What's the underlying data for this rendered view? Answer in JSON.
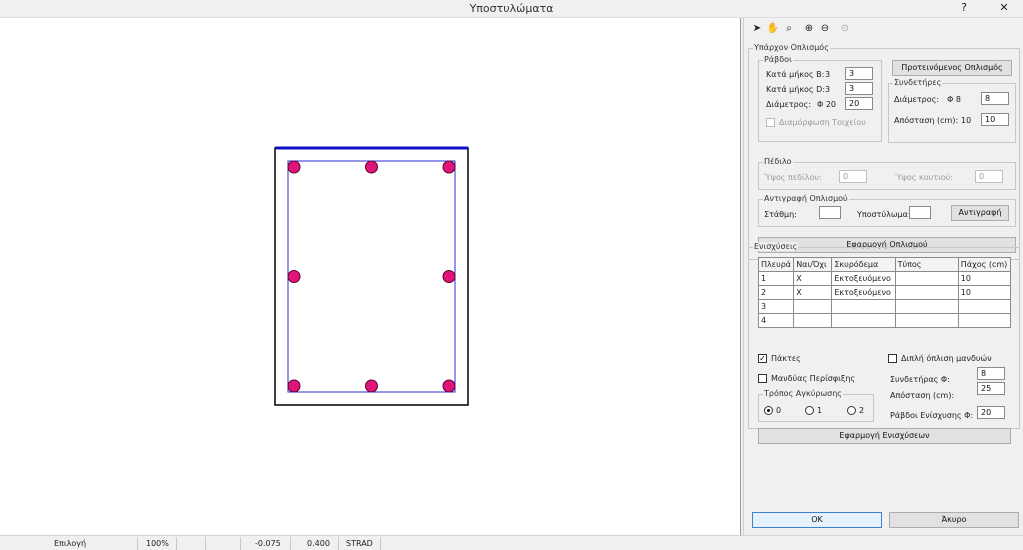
{
  "window": {
    "title": "Υποστυλώματα",
    "help_label": "?",
    "close_label": "✕"
  },
  "toolbar": {
    "icons": [
      "pointer-icon",
      "pan-hand-icon",
      "zoom-window-icon",
      "zoom-in-icon",
      "zoom-out-icon",
      "zoom-extents-icon"
    ]
  },
  "existing": {
    "title": "Υπάρχον Οπλισμός",
    "rebars": {
      "title": "Ράβδοι",
      "length_b_label": "Κατά μήκος Β:",
      "length_b_current": "3",
      "length_b_value": "3",
      "length_d_label": "Κατά μήκος D:",
      "length_d_current": "3",
      "length_d_value": "3",
      "diameter_label": "Διάμετρος:",
      "diameter_current": "Φ 20",
      "diameter_value": "20",
      "formwork_label": "Διαμόρφωση Τοιχείου"
    },
    "proposed_button": "Προτεινόμενος Οπλισμός",
    "stirrups": {
      "title": "Συνδετήρες",
      "diameter_label": "Διάμετρος:",
      "diameter_current": "Φ 8",
      "diameter_value": "8",
      "spacing_label": "Απόσταση (cm):",
      "spacing_current": "10",
      "spacing_value": "10"
    },
    "footing": {
      "title": "Πέδιλο",
      "footing_height_label": "Ύψος πεδίλου:",
      "footing_height_value": "0",
      "box_height_label": "Ύψος κουτιού:",
      "box_height_value": "0"
    },
    "copy": {
      "title": "Αντιγραφή Οπλισμού",
      "level_label": "Στάθμη:",
      "level_value": "",
      "column_label": "Υποστύλωμα:",
      "column_value": "",
      "copy_button": "Αντιγραφή"
    },
    "apply_button": "Εφαρμογή Οπλισμού"
  },
  "reinforcement": {
    "title": "Ενισχύσεις",
    "columns": [
      "Πλευρά",
      "Ναι/Όχι",
      "Σκυρόδεμα",
      "Τύπος",
      "Πάχος (cm)"
    ],
    "rows": [
      {
        "side": "1",
        "yesno": "X",
        "concrete": "Εκτοξευόμενο",
        "type": "",
        "thickness": "10"
      },
      {
        "side": "2",
        "yesno": "X",
        "concrete": "Εκτοξευόμενο",
        "type": "",
        "thickness": "10"
      },
      {
        "side": "3",
        "yesno": "",
        "concrete": "",
        "type": "",
        "thickness": ""
      },
      {
        "side": "4",
        "yesno": "",
        "concrete": "",
        "type": "",
        "thickness": ""
      }
    ],
    "full_height_label": "Πάκτες",
    "full_height_checked": true,
    "double_label": "Διπλή όπλιση μανδυών",
    "double_checked": false,
    "wrapping_label": "Μανδύας Περίσφιξης",
    "wrapping_checked": false,
    "stirrup_diam_label": "Συνδετήρας Φ:",
    "stirrup_diam_value": "8",
    "spacing_label": "Απόσταση (cm):",
    "spacing_value": "25",
    "anchorage": {
      "title": "Τρόπος Αγκύρωσης",
      "options": [
        "0",
        "1",
        "2"
      ],
      "selected": "0"
    },
    "rebar_diam_label": "Ράβδοι Ενίσχυσης Φ:",
    "rebar_diam_value": "20",
    "apply_button": "Εφαρμογή Ενισχύσεων"
  },
  "dialog_buttons": {
    "ok": "OK",
    "cancel": "Άκυρο"
  },
  "statusbar": {
    "mode": "Επιλογή",
    "zoom": "100%",
    "x": "-0.075",
    "y": "0.400",
    "snap": "STRAD"
  },
  "colors": {
    "section_outline": "#000000",
    "top_edge": "#1010c8",
    "stirrup": "#2b2bd6",
    "rebar_fill": "#e0157a"
  },
  "drawing": {
    "rebars_b": 3,
    "rebars_d": 3
  }
}
